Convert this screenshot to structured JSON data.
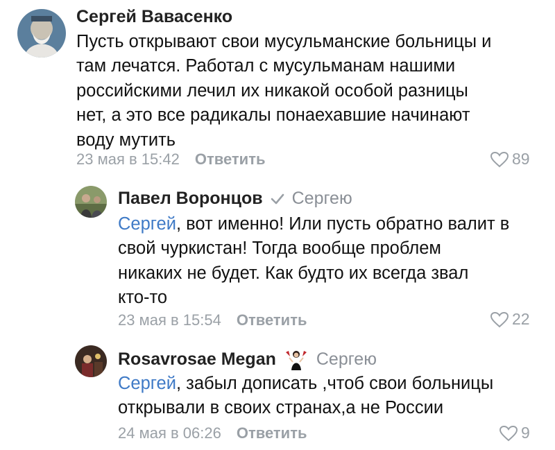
{
  "comments": [
    {
      "author": "Сергей Вавасенко",
      "lines": [
        "Пусть открывают свои мусульманские больницы и",
        "там лечатся. Работал с мусульманам нашими",
        "российскими лечил их никакой особой разницы",
        "нет, а это все радикалы понаехавшие начинают",
        "воду мутить"
      ],
      "date": "23 мая в 15:42",
      "reply_label": "Ответить",
      "likes": "89"
    },
    {
      "author": "Павел Воронцов",
      "reply_to": "Сергею",
      "mention": "Сергей",
      "lines": [
        ", вот именно! Или пусть обратно валит в",
        "свой чуркистан! Тогда вообще проблем",
        "никаких не будет. Как будто их всегда звал",
        "кто-то"
      ],
      "date": "23 мая в 15:54",
      "reply_label": "Ответить",
      "likes": "22"
    },
    {
      "author": "Rosavrosae Megan",
      "reply_to": "Сергею",
      "mention": "Сергей",
      "lines": [
        ", забыл дописать ,чтоб свои больницы",
        "открывали в своих странах,а не России"
      ],
      "date": "24 мая в 06:26",
      "reply_label": "Ответить",
      "likes": "9"
    }
  ],
  "colors": {
    "mention": "#3f7ac6",
    "meta": "#9aa0a6"
  },
  "icons": [
    "heart-icon",
    "verified-check-icon",
    "emoji-badge-icon"
  ]
}
